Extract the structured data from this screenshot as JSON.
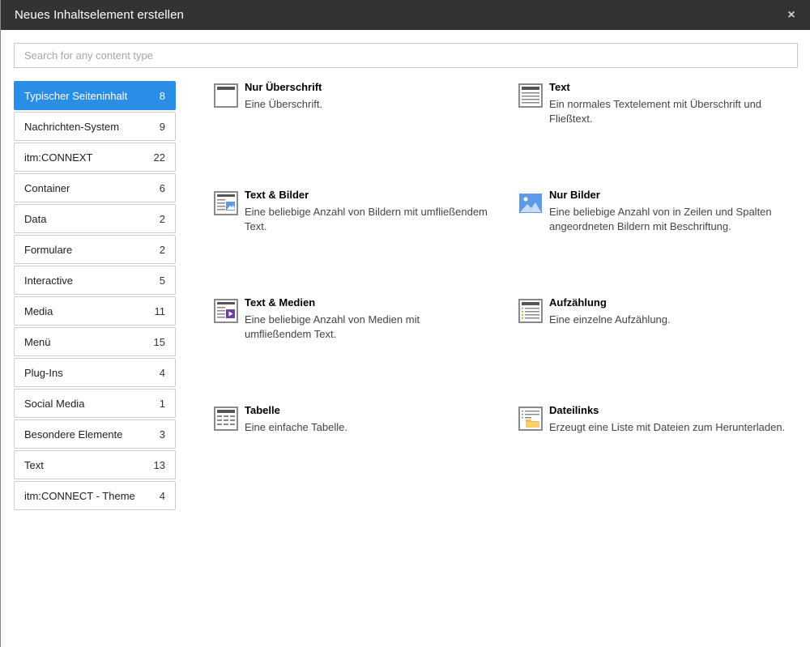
{
  "modal": {
    "title": "Neues Inhaltselement erstellen",
    "close": "×"
  },
  "search": {
    "placeholder": "Search for any content type",
    "value": ""
  },
  "sidebar": {
    "items": [
      {
        "label": "Typischer Seiteninhalt",
        "count": "8",
        "active": true
      },
      {
        "label": "Nachrichten-System",
        "count": "9"
      },
      {
        "label": "itm:CONNEXT",
        "count": "22"
      },
      {
        "label": "Container",
        "count": "6"
      },
      {
        "label": "Data",
        "count": "2"
      },
      {
        "label": "Formulare",
        "count": "2"
      },
      {
        "label": "Interactive",
        "count": "5"
      },
      {
        "label": "Media",
        "count": "11"
      },
      {
        "label": "Menü",
        "count": "15"
      },
      {
        "label": "Plug-Ins",
        "count": "4"
      },
      {
        "label": "Social Media",
        "count": "1"
      },
      {
        "label": "Besondere Elemente",
        "count": "3"
      },
      {
        "label": "Text",
        "count": "13"
      },
      {
        "label": "itm:CONNECT - Theme",
        "count": "4"
      }
    ]
  },
  "elements": [
    {
      "name": "Nur Überschrift",
      "desc": "Eine Überschrift.",
      "icon": "header-only-icon"
    },
    {
      "name": "Text",
      "desc": "Ein normales Textelement mit Überschrift und Fließtext.",
      "icon": "text-icon"
    },
    {
      "name": "Text & Bilder",
      "desc": "Eine beliebige Anzahl von Bildern mit umfließendem Text.",
      "icon": "text-images-icon"
    },
    {
      "name": "Nur Bilder",
      "desc": "Eine beliebige Anzahl von in Zeilen und Spalten angeordneten Bildern mit Beschriftung.",
      "icon": "images-only-icon"
    },
    {
      "name": "Text & Medien",
      "desc": "Eine beliebige Anzahl von Medien mit umfließendem Text.",
      "icon": "text-media-icon"
    },
    {
      "name": "Aufzählung",
      "desc": "Eine einzelne Aufzählung.",
      "icon": "bullet-list-icon"
    },
    {
      "name": "Tabelle",
      "desc": "Eine einfache Tabelle.",
      "icon": "table-icon"
    },
    {
      "name": "Dateilinks",
      "desc": "Erzeugt eine Liste mit Dateien zum Herunterladen.",
      "icon": "file-links-icon"
    }
  ],
  "colors": {
    "header_bg": "#333333",
    "active_bg": "#2a8ee6",
    "icon_gray": "#8a8a8a",
    "image_blue": "#5d9ae8",
    "media_purple": "#6d3fa3",
    "folder_yellow": "#f2bd4b"
  }
}
